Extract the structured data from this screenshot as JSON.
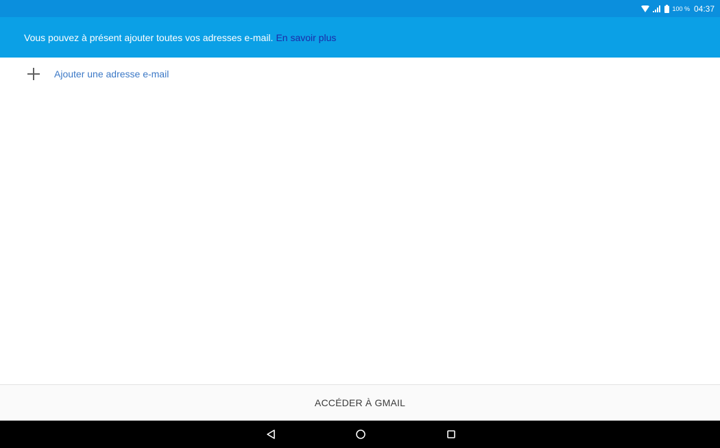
{
  "status_bar": {
    "icons": [
      "wifi-icon",
      "signal-icon",
      "battery-icon"
    ],
    "battery_percent": "100 %",
    "time": "04:37"
  },
  "banner": {
    "message": "Vous pouvez à présent ajouter toutes vos adresses e-mail.",
    "link_label": "En savoir plus"
  },
  "add_email": {
    "icon": "plus-icon",
    "label": "Ajouter une adresse e-mail"
  },
  "footer": {
    "button_label": "ACCÉDER À GMAIL"
  },
  "nav_bar": {
    "buttons": [
      "back-icon",
      "home-icon",
      "recent-apps-icon"
    ]
  },
  "colors": {
    "status_bar": "#0b8fdd",
    "banner": "#0ba0e6",
    "banner_link": "#1c2aa8",
    "add_label": "#3b78c6",
    "nav_bar": "#000000"
  }
}
